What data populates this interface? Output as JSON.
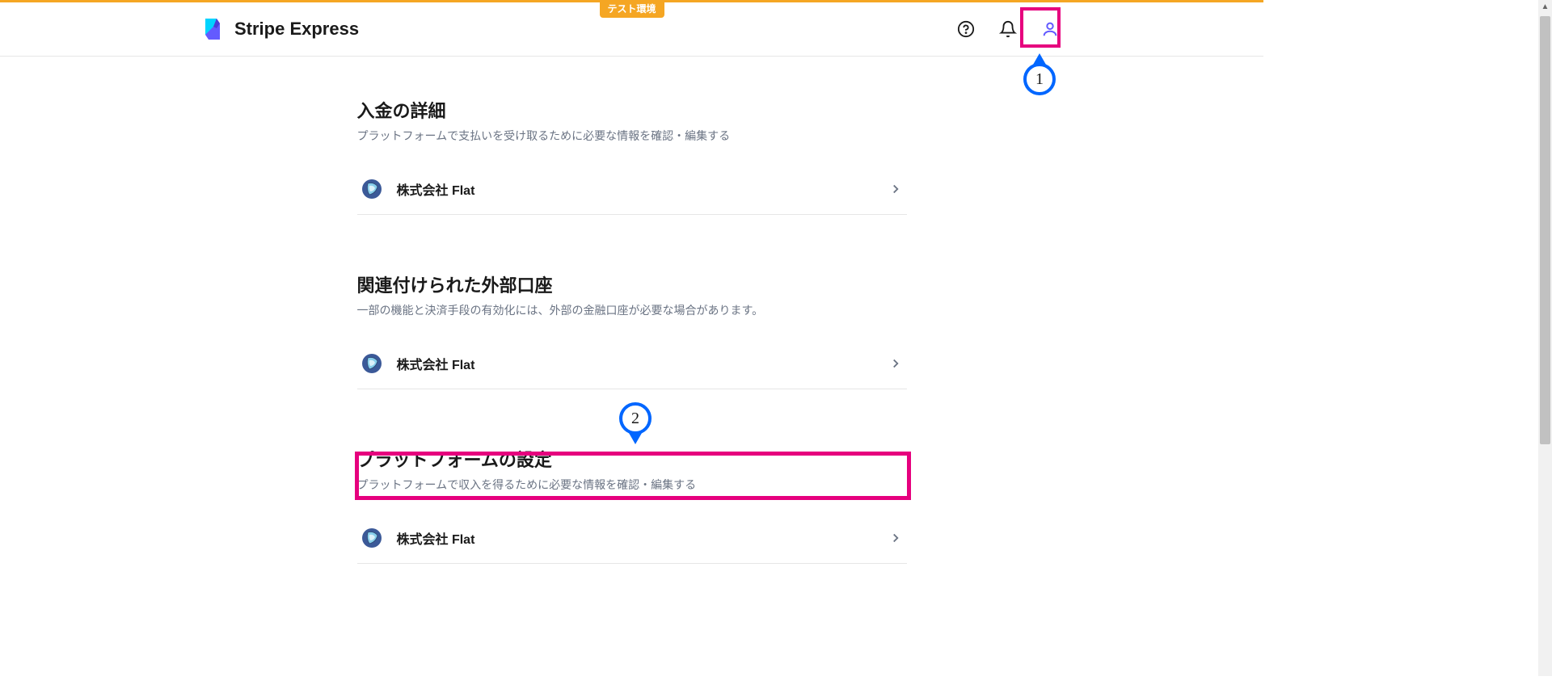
{
  "header": {
    "test_badge": "テスト環境",
    "title": "Stripe Express"
  },
  "sections": {
    "deposits": {
      "title": "入金の詳細",
      "desc": "プラットフォームで支払いを受け取るために必要な情報を確認・編集する",
      "item": "株式会社 Flat"
    },
    "external": {
      "title": "関連付けられた外部口座",
      "desc": "一部の機能と決済手段の有効化には、外部の金融口座が必要な場合があります。",
      "item": "株式会社 Flat"
    },
    "platform": {
      "title": "プラットフォームの設定",
      "desc": "プラットフォームで収入を得るために必要な情報を確認・編集する",
      "item": "株式会社 Flat"
    }
  },
  "annotations": {
    "num1": "1",
    "num2": "2"
  }
}
